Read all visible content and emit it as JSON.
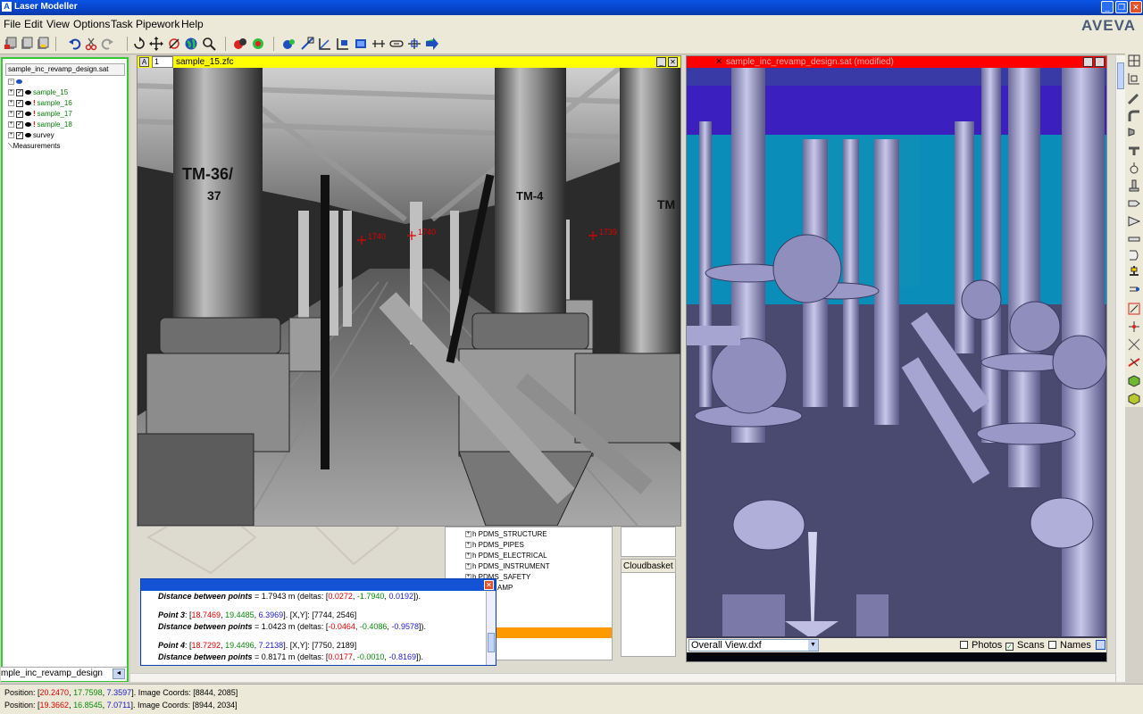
{
  "app": {
    "title": "Laser Modeller",
    "brand": "AVEVA"
  },
  "menu": [
    "File",
    "Edit",
    "View",
    "Options",
    "Task",
    "Pipework",
    "Help"
  ],
  "left_panel": {
    "title": "sample_inc_revamp_design.sat",
    "tree": [
      {
        "label": "sample_15",
        "checked": true,
        "warning": false
      },
      {
        "label": "sample_16",
        "checked": true,
        "warning": true
      },
      {
        "label": "sample_17",
        "checked": true,
        "warning": true
      },
      {
        "label": "sample_18",
        "checked": true,
        "warning": true
      },
      {
        "label": "survey",
        "checked": true,
        "warning": false
      }
    ],
    "measurements_label": "Measurements",
    "bottom_tab": "mple_inc_revamp_design"
  },
  "scan_view": {
    "view_number": "1",
    "title": "sample_15.zfc",
    "pipe_labels": [
      "TM-36/",
      "37",
      "TM-4",
      "TM"
    ],
    "markers": [
      "1740",
      "1740",
      "1739"
    ]
  },
  "model_view": {
    "title": "sample_inc_revamp_design.sat (modified)",
    "view_select": "Overall View.dxf",
    "options": [
      {
        "label": "Photos",
        "checked": false
      },
      {
        "label": "Scans",
        "checked": true
      },
      {
        "label": "Names",
        "checked": false
      }
    ]
  },
  "pdms_list": {
    "items": [
      "PDMS_STRUCTURE",
      "PDMS_PIPES",
      "PDMS_ELECTRICAL",
      "PDMS_INSTRUMENT",
      "PDMS_SAFETY",
      "AMP"
    ]
  },
  "cloudbasket": {
    "label": "Cloudbasket"
  },
  "measurement": {
    "line1": {
      "label": "Distance between points",
      "value": "= 1.7943 m (deltas: [",
      "x": "0.0272",
      "y": "-1.7940",
      "z": "0.0192",
      "tail": "])."
    },
    "point3": {
      "label": "Point 3",
      "pre": ": [",
      "x": "18.7469",
      "y": "19.4485",
      "z": "6.3969",
      "tail": "]. [X,Y]: [7744, 2546]"
    },
    "line3": {
      "label": "Distance between points",
      "value": "= 1.0423 m (deltas: [",
      "x": "-0.0464",
      "y": "-0.4086",
      "z": "-0.9578",
      "tail": "])."
    },
    "point4": {
      "label": "Point 4",
      "pre": ": [",
      "x": "18.7292",
      "y": "19.4496",
      "z": "7.2138",
      "tail": "]. [X,Y]: [7750, 2189]"
    },
    "line4": {
      "label": "Distance between points",
      "value": "= 0.8171 m (deltas: [",
      "x": "0.0177",
      "y": "-0.0010",
      "z": "-0.8169",
      "tail": "])."
    }
  },
  "status": {
    "line1": {
      "pre": "Position: [",
      "x": "20.2470",
      "y": "17.7598",
      "z": "7.3597",
      "tail": "]. Image Coords: [8844, 2085]"
    },
    "line2": {
      "pre": "Position: [",
      "x": "19.3662",
      "y": "16.8545",
      "z": "7.0711",
      "tail": "]. Image Coords: [8944, 2034]"
    }
  },
  "colors": {
    "scan_title_bg": "#ffff00",
    "model_title_bg": "#ff0000",
    "panel_border": "#35c935",
    "x_value": "#e00000",
    "y_value": "#0a8a0a",
    "z_value": "#1a1acc"
  }
}
